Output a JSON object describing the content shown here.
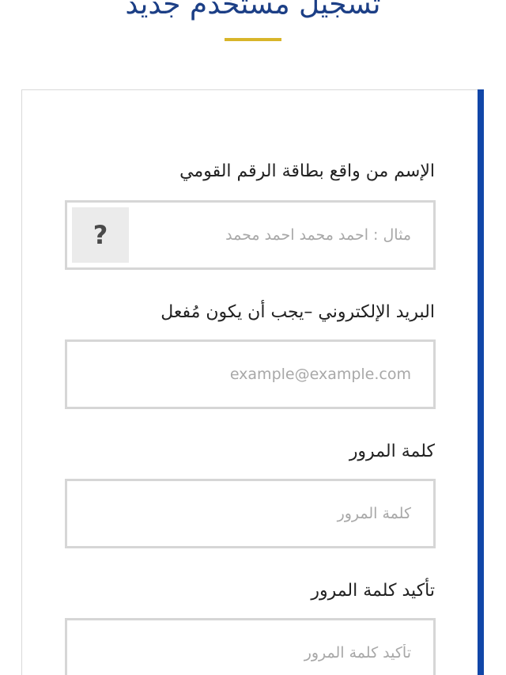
{
  "header": {
    "title": "تسجيل مستخدم جديد"
  },
  "form": {
    "fields": [
      {
        "label": "الإسم من واقع بطاقة الرقم القومي",
        "placeholder": "مثال : احمد محمد احمد محمد",
        "value": "",
        "help_icon": "question-mark-icon",
        "help_symbol": "?"
      },
      {
        "label": "البريد الإلكتروني –يجب أن يكون مُفعل",
        "placeholder": "example@example.com",
        "value": ""
      },
      {
        "label": "كلمة المرور",
        "placeholder": "كلمة المرور",
        "value": ""
      },
      {
        "label": "تأكيد كلمة المرور",
        "placeholder": "تأكيد كلمة المرور",
        "value": ""
      }
    ]
  },
  "colors": {
    "title": "#1c3f86",
    "title_underline": "#d8b52a",
    "card_accent": "#1146a8",
    "field_border": "#d6d6d6",
    "placeholder": "#a8a8a8"
  }
}
